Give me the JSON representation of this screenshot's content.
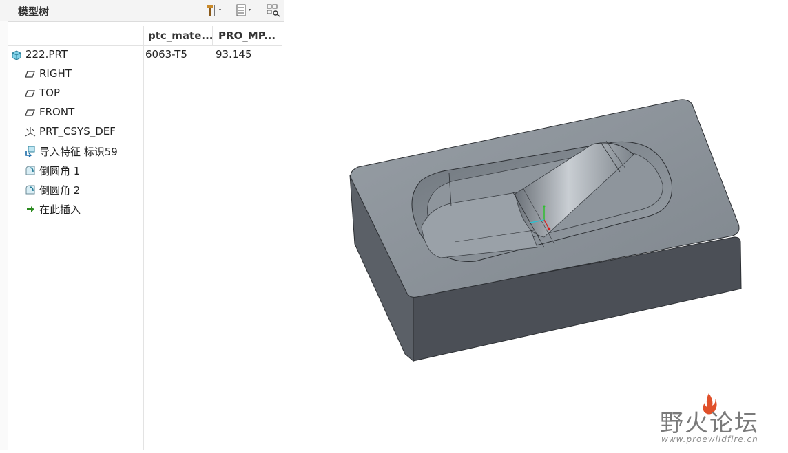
{
  "panel": {
    "title": "模型树",
    "toolbar": [
      {
        "icon": "tools-icon"
      },
      {
        "icon": "settings-list-icon"
      },
      {
        "icon": "column-filter-icon"
      }
    ]
  },
  "columns": [
    "ptc_mate...",
    "PRO_MP..."
  ],
  "tree": [
    {
      "label": "222.PRT",
      "icon": "part-icon",
      "material": "6063-T5",
      "mass": "93.145"
    },
    {
      "label": "RIGHT",
      "icon": "datum-plane-icon"
    },
    {
      "label": "TOP",
      "icon": "datum-plane-icon"
    },
    {
      "label": "FRONT",
      "icon": "datum-plane-icon"
    },
    {
      "label": "PRT_CSYS_DEF",
      "icon": "csys-icon"
    },
    {
      "label": "导入特征 标识59",
      "icon": "import-feature-icon"
    },
    {
      "label": "倒圆角 1",
      "icon": "round-icon"
    },
    {
      "label": "倒圆角 2",
      "icon": "round-icon"
    },
    {
      "label": "在此插入",
      "icon": "insert-here-arrow-icon"
    }
  ],
  "watermark": {
    "title": "野火论坛",
    "url": "www.proewildfire.cn"
  },
  "colors": {
    "part_face_top": "#8c939a",
    "part_face_side": "#5a5f66",
    "part_face_front": "#4a4e55",
    "flame": "#e0502a"
  }
}
